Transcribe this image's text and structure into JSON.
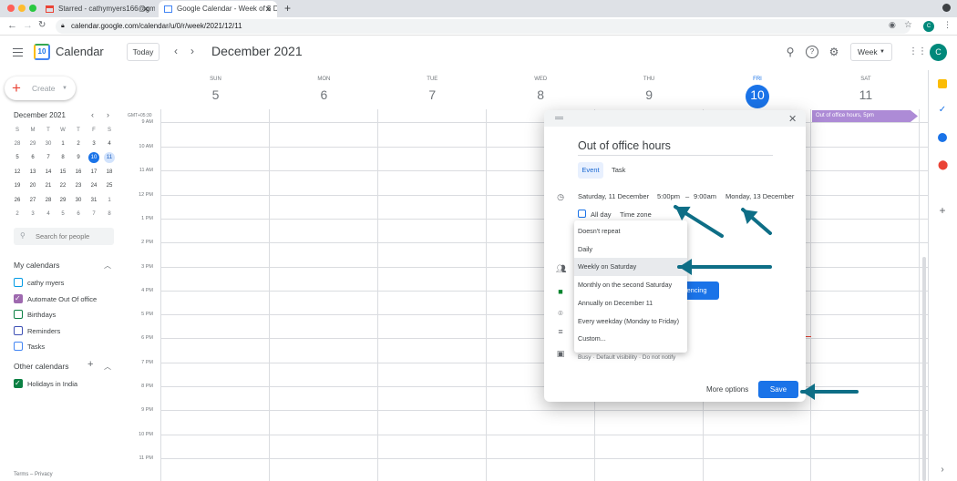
{
  "browser": {
    "tabs": [
      {
        "label": "Starred - cathymyers166@gm..."
      },
      {
        "label": "Google Calendar - Week of 5 D..."
      }
    ],
    "url": "calendar.google.com/calendar/u/0/r/week/2021/12/11",
    "profile_initial": "C"
  },
  "header": {
    "app_name": "Calendar",
    "logo_text": "10",
    "today_label": "Today",
    "month_title": "December 2021",
    "view_label": "Week",
    "avatar_initial": "C"
  },
  "sidebar": {
    "create_label": "Create",
    "mini_month": {
      "title": "December 2021",
      "weekdays": [
        "S",
        "M",
        "T",
        "W",
        "T",
        "F",
        "S"
      ],
      "weeks": [
        [
          "28",
          "29",
          "30",
          "1",
          "2",
          "3",
          "4"
        ],
        [
          "5",
          "6",
          "7",
          "8",
          "9",
          "10",
          "11"
        ],
        [
          "12",
          "13",
          "14",
          "15",
          "16",
          "17",
          "18"
        ],
        [
          "19",
          "20",
          "21",
          "22",
          "23",
          "24",
          "25"
        ],
        [
          "26",
          "27",
          "28",
          "29",
          "30",
          "31",
          "1"
        ],
        [
          "2",
          "3",
          "4",
          "5",
          "6",
          "7",
          "8"
        ]
      ]
    },
    "search_placeholder": "Search for people",
    "my_calendars_title": "My calendars",
    "my_calendars": [
      {
        "label": "cathy myers",
        "color": "#039be5",
        "checked": false
      },
      {
        "label": "Automate Out Of office",
        "color": "#9e69af",
        "checked": true
      },
      {
        "label": "Birthdays",
        "color": "#0b8043",
        "checked": false
      },
      {
        "label": "Reminders",
        "color": "#3f51b5",
        "checked": false
      },
      {
        "label": "Tasks",
        "color": "#4285f4",
        "checked": false
      }
    ],
    "other_calendars_title": "Other calendars",
    "other_calendars": [
      {
        "label": "Holidays in India",
        "color": "#0b8043",
        "checked": true
      }
    ],
    "footer": "Terms – Privacy"
  },
  "week": {
    "days": [
      {
        "name": "SUN",
        "num": "5"
      },
      {
        "name": "MON",
        "num": "6"
      },
      {
        "name": "TUE",
        "num": "7"
      },
      {
        "name": "WED",
        "num": "8"
      },
      {
        "name": "THU",
        "num": "9"
      },
      {
        "name": "FRI",
        "num": "10"
      },
      {
        "name": "SAT",
        "num": "11"
      }
    ],
    "gmt": "GMT+05:30",
    "hours": [
      "10 AM",
      "11 AM",
      "12 PM",
      "1 PM",
      "2 PM",
      "3 PM",
      "4 PM",
      "5 PM",
      "6 PM",
      "7 PM",
      "8 PM",
      "9 PM",
      "10 PM",
      "11 PM"
    ],
    "top_hour_partial": "9 AM",
    "event_label": "Out of office hours, 5pm",
    "event_color": "#ad8bd6"
  },
  "dialog": {
    "title": "Out of office hours",
    "tab_event": "Event",
    "tab_task": "Task",
    "start_date": "Saturday, 11 December",
    "start_time": "5:00pm",
    "dash": "–",
    "end_time": "9:00am",
    "end_date": "Monday, 13 December",
    "all_day": "All day",
    "time_zone": "Time zone",
    "conferencing_fragment": "rencing",
    "busy_text": "Busy · Default visibility · Do not notify",
    "more_options": "More options",
    "save": "Save"
  },
  "repeat_menu": {
    "options": [
      "Doesn't repeat",
      "Daily",
      "Weekly on Saturday",
      "Monthly on the second Saturday",
      "Annually on December 11",
      "Every weekday (Monday to Friday)",
      "Custom..."
    ],
    "highlighted_index": 2
  },
  "annotation_color": "#0e6e86",
  "accent": "#1a73e8"
}
